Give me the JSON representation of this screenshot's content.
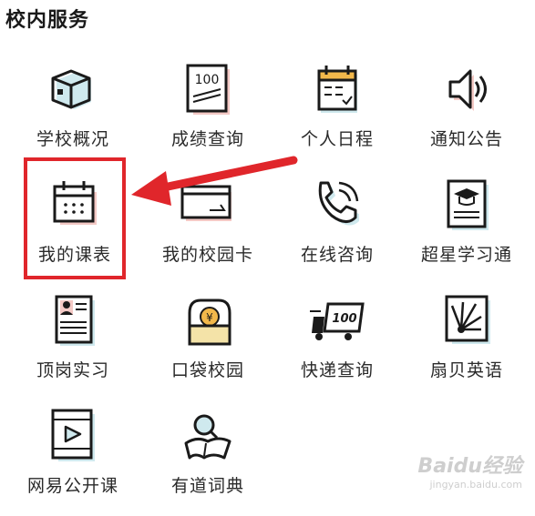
{
  "section": {
    "title": "校内服务"
  },
  "services": [
    {
      "label": "学校概况",
      "icon": "box-icon"
    },
    {
      "label": "成绩查询",
      "icon": "score-sheet-icon"
    },
    {
      "label": "个人日程",
      "icon": "calendar-check-icon"
    },
    {
      "label": "通知公告",
      "icon": "speaker-icon"
    },
    {
      "label": "我的课表",
      "icon": "schedule-calendar-icon"
    },
    {
      "label": "我的校园卡",
      "icon": "campus-card-icon"
    },
    {
      "label": "在线咨询",
      "icon": "phone-icon"
    },
    {
      "label": "超星学习通",
      "icon": "graduation-cap-icon"
    },
    {
      "label": "顶岗实习",
      "icon": "profile-card-icon"
    },
    {
      "label": "口袋校园",
      "icon": "wallet-icon"
    },
    {
      "label": "快递查询",
      "icon": "delivery-truck-icon"
    },
    {
      "label": "扇贝英语",
      "icon": "shell-icon"
    },
    {
      "label": "网易公开课",
      "icon": "video-play-icon"
    },
    {
      "label": "有道词典",
      "icon": "dictionary-icon"
    }
  ],
  "truck_badge": "100",
  "score_badge": "100",
  "wallet_badge": "¥",
  "annotation": {
    "highlight_color": "#e0262b",
    "arrow_color": "#e0262b"
  },
  "watermark": {
    "main": "Baidu经验",
    "sub": "jingyan.baidu.com"
  }
}
